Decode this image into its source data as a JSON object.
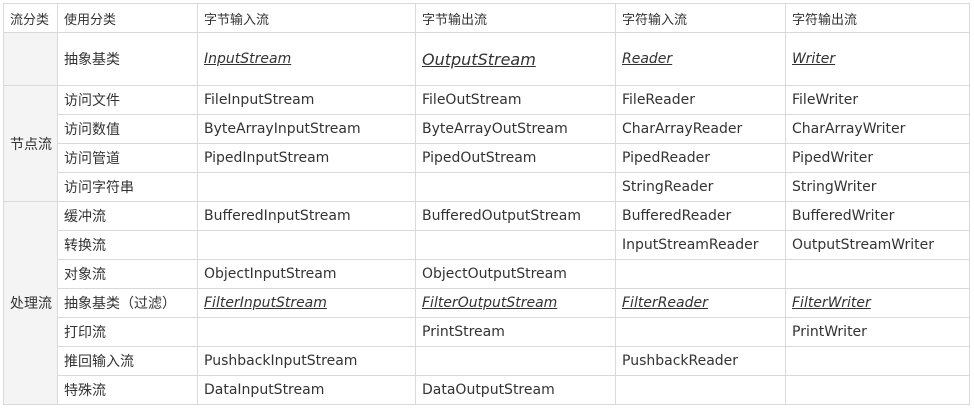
{
  "headers": [
    "流分类",
    "使用分类",
    "字节输入流",
    "字节输出流",
    "字符输入流",
    "字符输出流"
  ],
  "abstract_row": {
    "usage": "抽象基类",
    "byte_in": "InputStream",
    "byte_out": "OutputStream",
    "char_in": "Reader",
    "char_out": "Writer"
  },
  "node_stream": {
    "label": "节点流",
    "rows": [
      {
        "usage": "访问文件",
        "byte_in": "FileInputStream",
        "byte_out": "FileOutStream",
        "char_in": "FileReader",
        "char_out": "FileWriter"
      },
      {
        "usage": "访问数值",
        "byte_in": "ByteArrayInputStream",
        "byte_out": "ByteArrayOutStream",
        "char_in": "CharArrayReader",
        "char_out": "CharArrayWriter"
      },
      {
        "usage": "访问管道",
        "byte_in": "PipedInputStream",
        "byte_out": "PipedOutStream",
        "char_in": "PipedReader",
        "char_out": "PipedWriter"
      },
      {
        "usage": "访问字符串",
        "byte_in": "",
        "byte_out": "",
        "char_in": "StringReader",
        "char_out": "StringWriter"
      }
    ]
  },
  "processing_stream": {
    "label": "处理流",
    "rows": [
      {
        "usage": "缓冲流",
        "byte_in": "BufferedInputStream",
        "byte_out": "BufferedOutputStream",
        "char_in": "BufferedReader",
        "char_out": "BufferedWriter"
      },
      {
        "usage": "转换流",
        "byte_in": "",
        "byte_out": "",
        "char_in": "InputStreamReader",
        "char_out": "OutputStreamWriter"
      },
      {
        "usage": "对象流",
        "byte_in": "ObjectInputStream",
        "byte_out": "ObjectOutputStream",
        "char_in": "",
        "char_out": ""
      },
      {
        "usage": "抽象基类（过滤）",
        "byte_in": "FilterInputStream",
        "byte_out": "FilterOutputStream",
        "char_in": "FilterReader",
        "char_out": "FilterWriter"
      },
      {
        "usage": "打印流",
        "byte_in": "",
        "byte_out": "PrintStream",
        "char_in": "",
        "char_out": "PrintWriter"
      },
      {
        "usage": "推回输入流",
        "byte_in": "PushbackInputStream",
        "byte_out": "",
        "char_in": "PushbackReader",
        "char_out": ""
      },
      {
        "usage": "特殊流",
        "byte_in": "DataInputStream",
        "byte_out": "DataOutputStream",
        "char_in": "",
        "char_out": ""
      }
    ]
  }
}
